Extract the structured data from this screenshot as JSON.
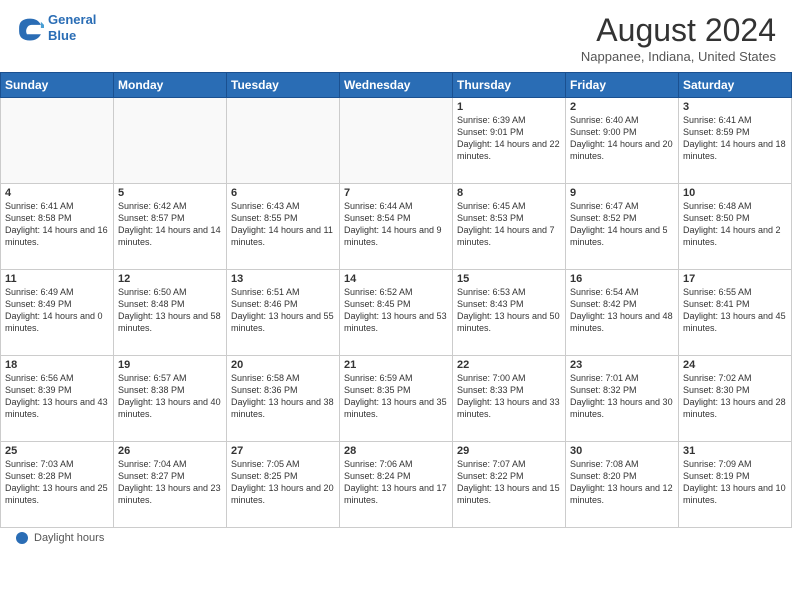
{
  "header": {
    "logo_line1": "General",
    "logo_line2": "Blue",
    "month_title": "August 2024",
    "location": "Nappanee, Indiana, United States"
  },
  "weekdays": [
    "Sunday",
    "Monday",
    "Tuesday",
    "Wednesday",
    "Thursday",
    "Friday",
    "Saturday"
  ],
  "weeks": [
    [
      {
        "day": "",
        "sunrise": "",
        "sunset": "",
        "daylight": ""
      },
      {
        "day": "",
        "sunrise": "",
        "sunset": "",
        "daylight": ""
      },
      {
        "day": "",
        "sunrise": "",
        "sunset": "",
        "daylight": ""
      },
      {
        "day": "",
        "sunrise": "",
        "sunset": "",
        "daylight": ""
      },
      {
        "day": "1",
        "sunrise": "Sunrise: 6:39 AM",
        "sunset": "Sunset: 9:01 PM",
        "daylight": "Daylight: 14 hours and 22 minutes."
      },
      {
        "day": "2",
        "sunrise": "Sunrise: 6:40 AM",
        "sunset": "Sunset: 9:00 PM",
        "daylight": "Daylight: 14 hours and 20 minutes."
      },
      {
        "day": "3",
        "sunrise": "Sunrise: 6:41 AM",
        "sunset": "Sunset: 8:59 PM",
        "daylight": "Daylight: 14 hours and 18 minutes."
      }
    ],
    [
      {
        "day": "4",
        "sunrise": "Sunrise: 6:41 AM",
        "sunset": "Sunset: 8:58 PM",
        "daylight": "Daylight: 14 hours and 16 minutes."
      },
      {
        "day": "5",
        "sunrise": "Sunrise: 6:42 AM",
        "sunset": "Sunset: 8:57 PM",
        "daylight": "Daylight: 14 hours and 14 minutes."
      },
      {
        "day": "6",
        "sunrise": "Sunrise: 6:43 AM",
        "sunset": "Sunset: 8:55 PM",
        "daylight": "Daylight: 14 hours and 11 minutes."
      },
      {
        "day": "7",
        "sunrise": "Sunrise: 6:44 AM",
        "sunset": "Sunset: 8:54 PM",
        "daylight": "Daylight: 14 hours and 9 minutes."
      },
      {
        "day": "8",
        "sunrise": "Sunrise: 6:45 AM",
        "sunset": "Sunset: 8:53 PM",
        "daylight": "Daylight: 14 hours and 7 minutes."
      },
      {
        "day": "9",
        "sunrise": "Sunrise: 6:47 AM",
        "sunset": "Sunset: 8:52 PM",
        "daylight": "Daylight: 14 hours and 5 minutes."
      },
      {
        "day": "10",
        "sunrise": "Sunrise: 6:48 AM",
        "sunset": "Sunset: 8:50 PM",
        "daylight": "Daylight: 14 hours and 2 minutes."
      }
    ],
    [
      {
        "day": "11",
        "sunrise": "Sunrise: 6:49 AM",
        "sunset": "Sunset: 8:49 PM",
        "daylight": "Daylight: 14 hours and 0 minutes."
      },
      {
        "day": "12",
        "sunrise": "Sunrise: 6:50 AM",
        "sunset": "Sunset: 8:48 PM",
        "daylight": "Daylight: 13 hours and 58 minutes."
      },
      {
        "day": "13",
        "sunrise": "Sunrise: 6:51 AM",
        "sunset": "Sunset: 8:46 PM",
        "daylight": "Daylight: 13 hours and 55 minutes."
      },
      {
        "day": "14",
        "sunrise": "Sunrise: 6:52 AM",
        "sunset": "Sunset: 8:45 PM",
        "daylight": "Daylight: 13 hours and 53 minutes."
      },
      {
        "day": "15",
        "sunrise": "Sunrise: 6:53 AM",
        "sunset": "Sunset: 8:43 PM",
        "daylight": "Daylight: 13 hours and 50 minutes."
      },
      {
        "day": "16",
        "sunrise": "Sunrise: 6:54 AM",
        "sunset": "Sunset: 8:42 PM",
        "daylight": "Daylight: 13 hours and 48 minutes."
      },
      {
        "day": "17",
        "sunrise": "Sunrise: 6:55 AM",
        "sunset": "Sunset: 8:41 PM",
        "daylight": "Daylight: 13 hours and 45 minutes."
      }
    ],
    [
      {
        "day": "18",
        "sunrise": "Sunrise: 6:56 AM",
        "sunset": "Sunset: 8:39 PM",
        "daylight": "Daylight: 13 hours and 43 minutes."
      },
      {
        "day": "19",
        "sunrise": "Sunrise: 6:57 AM",
        "sunset": "Sunset: 8:38 PM",
        "daylight": "Daylight: 13 hours and 40 minutes."
      },
      {
        "day": "20",
        "sunrise": "Sunrise: 6:58 AM",
        "sunset": "Sunset: 8:36 PM",
        "daylight": "Daylight: 13 hours and 38 minutes."
      },
      {
        "day": "21",
        "sunrise": "Sunrise: 6:59 AM",
        "sunset": "Sunset: 8:35 PM",
        "daylight": "Daylight: 13 hours and 35 minutes."
      },
      {
        "day": "22",
        "sunrise": "Sunrise: 7:00 AM",
        "sunset": "Sunset: 8:33 PM",
        "daylight": "Daylight: 13 hours and 33 minutes."
      },
      {
        "day": "23",
        "sunrise": "Sunrise: 7:01 AM",
        "sunset": "Sunset: 8:32 PM",
        "daylight": "Daylight: 13 hours and 30 minutes."
      },
      {
        "day": "24",
        "sunrise": "Sunrise: 7:02 AM",
        "sunset": "Sunset: 8:30 PM",
        "daylight": "Daylight: 13 hours and 28 minutes."
      }
    ],
    [
      {
        "day": "25",
        "sunrise": "Sunrise: 7:03 AM",
        "sunset": "Sunset: 8:28 PM",
        "daylight": "Daylight: 13 hours and 25 minutes."
      },
      {
        "day": "26",
        "sunrise": "Sunrise: 7:04 AM",
        "sunset": "Sunset: 8:27 PM",
        "daylight": "Daylight: 13 hours and 23 minutes."
      },
      {
        "day": "27",
        "sunrise": "Sunrise: 7:05 AM",
        "sunset": "Sunset: 8:25 PM",
        "daylight": "Daylight: 13 hours and 20 minutes."
      },
      {
        "day": "28",
        "sunrise": "Sunrise: 7:06 AM",
        "sunset": "Sunset: 8:24 PM",
        "daylight": "Daylight: 13 hours and 17 minutes."
      },
      {
        "day": "29",
        "sunrise": "Sunrise: 7:07 AM",
        "sunset": "Sunset: 8:22 PM",
        "daylight": "Daylight: 13 hours and 15 minutes."
      },
      {
        "day": "30",
        "sunrise": "Sunrise: 7:08 AM",
        "sunset": "Sunset: 8:20 PM",
        "daylight": "Daylight: 13 hours and 12 minutes."
      },
      {
        "day": "31",
        "sunrise": "Sunrise: 7:09 AM",
        "sunset": "Sunset: 8:19 PM",
        "daylight": "Daylight: 13 hours and 10 minutes."
      }
    ]
  ],
  "footer": {
    "label": "Daylight hours"
  }
}
